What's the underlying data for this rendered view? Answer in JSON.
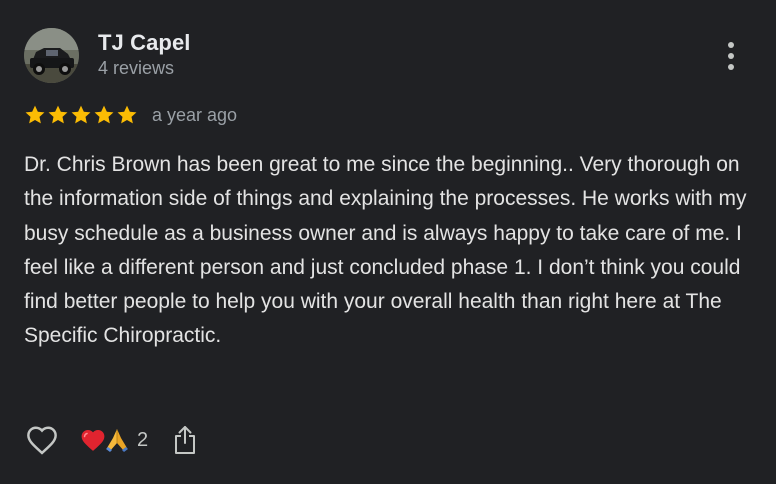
{
  "review": {
    "author": {
      "name": "TJ Capel",
      "review_count": "4 reviews",
      "avatar_icon": "truck-photo-avatar"
    },
    "rating": {
      "stars": 5,
      "max": 5,
      "star_color": "#fbbc04"
    },
    "time": "a year ago",
    "text": "Dr. Chris Brown has been great to me since the beginning.. Very thorough on the information side of things and explaining the processes. He works with my busy schedule as a business owner and is always happy to take care of me. I feel like a different person and just concluded phase 1. I don’t think you could find better people to help you with your overall health than right here at The Specific Chiropractic."
  },
  "actions": {
    "like_icon": "heart-outline-icon",
    "reactions": {
      "icons": [
        "red-heart-icon",
        "folded-hands-icon"
      ],
      "count": "2"
    },
    "share_icon": "share-icon",
    "more_icon": "more-vertical-icon"
  },
  "colors": {
    "background": "#202124",
    "primary_text": "#e8eaed",
    "secondary_text": "#9aa0a6"
  }
}
